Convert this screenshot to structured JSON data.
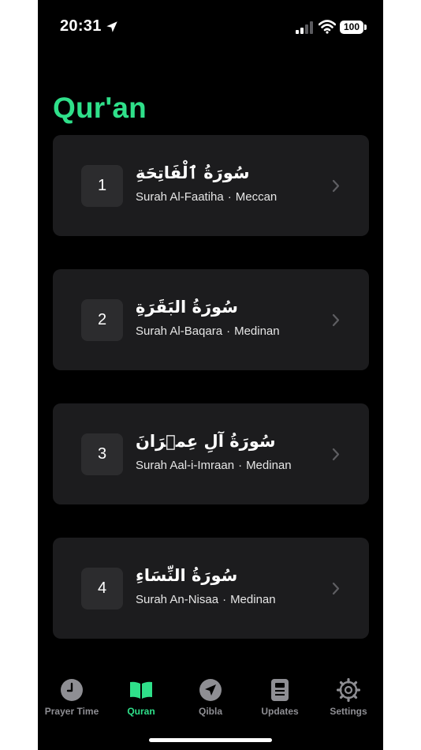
{
  "status_bar": {
    "time": "20:31",
    "battery": "100",
    "icons": [
      "location-arrow-icon",
      "cellular-signal-icon",
      "wifi-icon",
      "battery-icon"
    ]
  },
  "page": {
    "title": "Qur'an"
  },
  "surahs": [
    {
      "number": "1",
      "arabic": "سُورَةُ ٱلْفَاتِحَةِ",
      "name": "Surah Al-Faatiha",
      "separator": "·",
      "type": "Meccan"
    },
    {
      "number": "2",
      "arabic": "سُورَةُ البَقَرَةِ",
      "name": "Surah Al-Baqara",
      "separator": "·",
      "type": "Medinan"
    },
    {
      "number": "3",
      "arabic": "سُورَةُ آلِ عِمۡرَانَ",
      "name": "Surah Aal-i-Imraan",
      "separator": "·",
      "type": "Medinan"
    },
    {
      "number": "4",
      "arabic": "سُورَةُ النِّسَاءِ",
      "name": "Surah An-Nisaa",
      "separator": "·",
      "type": "Medinan"
    }
  ],
  "tabs": [
    {
      "label": "Prayer Time",
      "icon": "clock-icon",
      "active": false
    },
    {
      "label": "Quran",
      "icon": "open-book-icon",
      "active": true
    },
    {
      "label": "Qibla",
      "icon": "compass-arrow-icon",
      "active": false
    },
    {
      "label": "Updates",
      "icon": "document-icon",
      "active": false
    },
    {
      "label": "Settings",
      "icon": "gear-icon",
      "active": false
    }
  ],
  "colors": {
    "accent": "#2fe08a",
    "inactive": "#8e8e93",
    "background": "#000000",
    "card": "#1c1c1e",
    "number_box": "#2c2c2e"
  }
}
